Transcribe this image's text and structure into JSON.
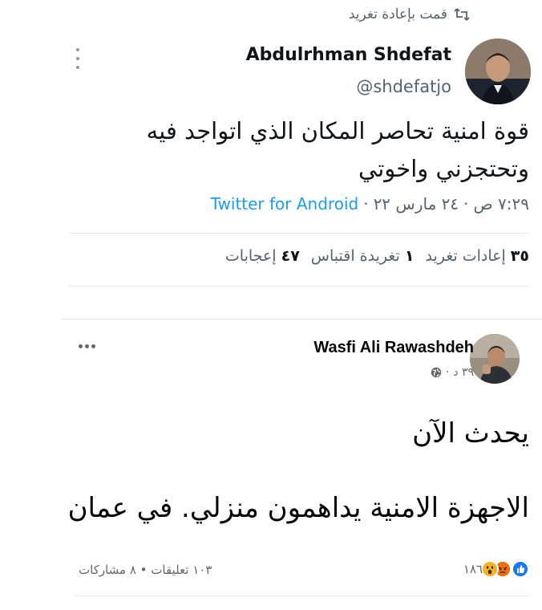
{
  "tweet": {
    "retweet_label": "قمت بإعادة تغريد",
    "author_name": "Abdulrhman Shdefat",
    "author_handle": "@shdefatjo",
    "text_line_1": "قوة امنية تحاصر المكان الذي اتواجد فيه",
    "text_line_2": "وتحتجزني واخوتي",
    "time": "٧:٢٩ ص",
    "date": "٢٤ مارس ٢٢",
    "source": "Twitter for Android",
    "separator": "·",
    "stats": {
      "retweets_count": "٣٥",
      "retweets_label": "إعادات تغريد",
      "quotes_count": "١",
      "quotes_label": "تغريدة اقتباس",
      "likes_count": "٤٧",
      "likes_label": "إعجابات"
    },
    "accent_color": "#1d9bf0"
  },
  "facebook_post": {
    "author_name": "Wasfi Ali Rawashdeh",
    "time_ago": "٣٩ د",
    "separator": "·",
    "privacy_icon": "globe-icon",
    "text_line_1": "يحدث الآن",
    "text_line_2": "الاجهزة الامنية يداهمون منزلي. في عمان",
    "reactions": {
      "icons": [
        "like-icon",
        "angry-icon",
        "wow-icon"
      ],
      "count": "١٨٦"
    },
    "counts_text": "١٠٣ تعليقات • ٨ مشاركات"
  }
}
